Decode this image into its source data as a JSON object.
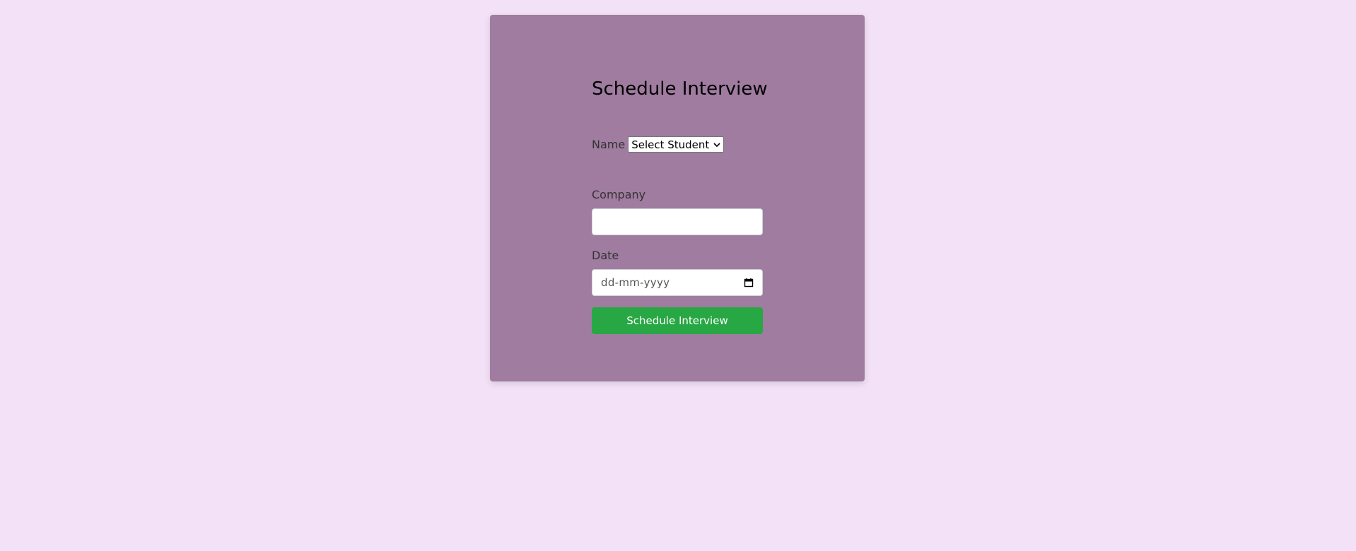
{
  "form": {
    "title": "Schedule Interview",
    "name_label": "Name",
    "name_select_value": "Select Student",
    "company_label": "Company",
    "company_value": "",
    "date_label": "Date",
    "date_placeholder": "dd-mm-yyyy",
    "submit_label": "Schedule Interview"
  },
  "icons": {
    "select": "chevron-down-icon",
    "date": "calendar-icon"
  },
  "colors": {
    "page_background": "#f3e1f7",
    "card_background": "#a07ca0",
    "submit_button": "#28a745"
  }
}
